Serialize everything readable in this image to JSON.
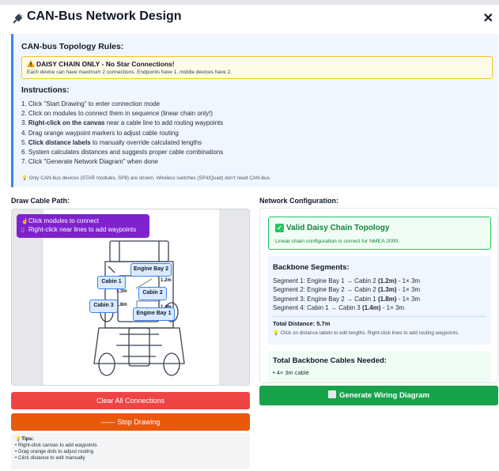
{
  "header": {
    "title": "CAN-Bus Network Design",
    "close_glyph": "✕"
  },
  "rules": {
    "title": "CAN-bus Topology Rules:",
    "warning_title": "DAISY CHAIN ONLY - No Star Connections!",
    "warning_desc": "Each device can have maximum 2 connections. Endpoints have 1, middle devices have 2.",
    "instructions_title": "Instructions:",
    "steps": [
      {
        "pre": "1. Click \"Start Drawing\" to enter connection mode",
        "bold": "",
        "post": ""
      },
      {
        "pre": "2. Click on modules to connect them in sequence (linear chain only!)",
        "bold": "",
        "post": ""
      },
      {
        "pre": "3. ",
        "bold": "Right-click on the canvas",
        "post": " near a cable line to add routing waypoints"
      },
      {
        "pre": "4. Drag orange waypoint markers to adjust cable routing",
        "bold": "",
        "post": ""
      },
      {
        "pre": "5. ",
        "bold": "Click distance labels",
        "post": " to manually override calculated lengths"
      },
      {
        "pre": "6. System calculates distances and suggests proper cable combinations",
        "bold": "",
        "post": ""
      },
      {
        "pre": "7. Click \"Generate Network Diagram\" when done",
        "bold": "",
        "post": ""
      }
    ],
    "note": "Only CAN-bus devices (STAR modules, SP8) are shown. Wireless switches (SP4/Quad) don't need CAN-bus."
  },
  "draw": {
    "label": "Draw Cable Path:",
    "hint_line1": "Click modules to connect",
    "hint_line2": "Right-click near lines to add waypoints",
    "modules": {
      "engine_bay_2": "Engine Bay 2",
      "cabin_1": "Cabin 1",
      "cabin_2": "Cabin 2",
      "cabin_3": "Cabin 3",
      "engine_bay_1": "Engine Bay 1"
    },
    "distances": {
      "d1": "1.2m",
      "d2": "1.3m",
      "d3": "1.8m",
      "d4": "1.4m"
    }
  },
  "buttons": {
    "clear": "Clear All Connections",
    "stop": "—— Stop Drawing",
    "generate": "Generate Wiring Diagram"
  },
  "tips": {
    "title": "Tips:",
    "items": [
      "• Right-click canvas to add waypoints",
      "• Drag orange dots to adjust routing",
      "• Click distance to edit manually"
    ]
  },
  "config": {
    "label": "Network Configuration:",
    "valid_title": "Valid Daisy Chain Topology",
    "valid_desc": "Linear chain configuration is correct for NMEA 2000.",
    "segments_title": "Backbone Segments:",
    "segments": [
      {
        "text": "Segment 1: Engine Bay 1 → Cabin 2 ",
        "len": "(1.2m)",
        "cable": " - 1× 3m"
      },
      {
        "text": "Segment 2: Engine Bay 2 → Cabin 2 ",
        "len": "(1.3m)",
        "cable": " - 1× 3m"
      },
      {
        "text": "Segment 3: Engine Bay 2 → Cabin 1 ",
        "len": "(1.8m)",
        "cable": " - 1× 3m"
      },
      {
        "text": "Segment 4: Cabin 1 → Cabin 3 ",
        "len": "(1.4m)",
        "cable": " - 1× 3m"
      }
    ],
    "total": "Total Distance: 5.7m",
    "segments_note": "Click on distance labels to edit lengths. Right-click lines to add routing waypoints.",
    "cables_title": "Total Backbone Cables Needed:",
    "cables_item": "• 4× 3m cable"
  },
  "colors": {
    "accent_blue": "#3b82f6",
    "valid_green": "#22c55e",
    "clear_red": "#ef4444",
    "stop_orange": "#ea580c",
    "generate_green": "#16a34a",
    "hint_purple": "#7e22ce"
  }
}
